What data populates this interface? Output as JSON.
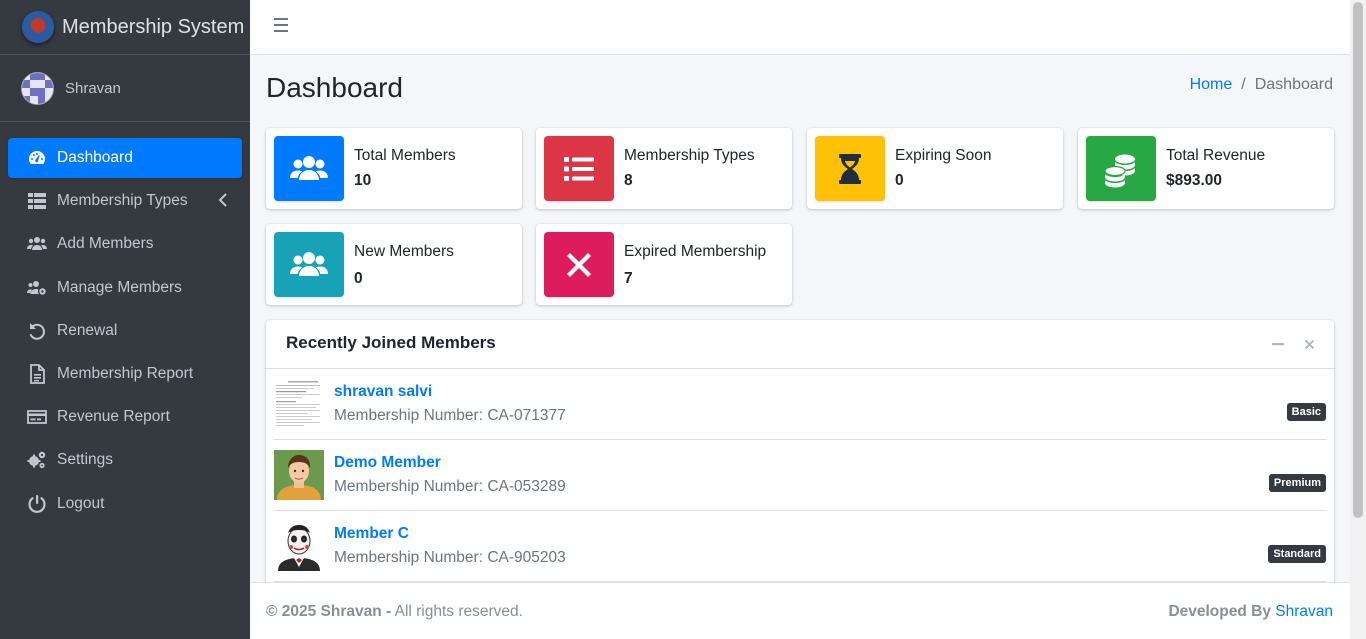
{
  "brand": {
    "title": "Membership System"
  },
  "user": {
    "name": "Shravan"
  },
  "sidebar": {
    "items": [
      {
        "label": "Dashboard",
        "icon": "tachometer-icon",
        "active": true
      },
      {
        "label": "Membership Types",
        "icon": "table-icon",
        "has_submenu": true
      },
      {
        "label": "Add Members",
        "icon": "users-icon"
      },
      {
        "label": "Manage Members",
        "icon": "users-cog-icon"
      },
      {
        "label": "Renewal",
        "icon": "undo-icon"
      },
      {
        "label": "Membership Report",
        "icon": "file-icon"
      },
      {
        "label": "Revenue Report",
        "icon": "credit-card-icon"
      },
      {
        "label": "Settings",
        "icon": "cogs-icon"
      },
      {
        "label": "Logout",
        "icon": "power-off-icon"
      }
    ]
  },
  "header": {
    "title": "Dashboard"
  },
  "breadcrumb": {
    "home": "Home",
    "current": "Dashboard",
    "separator": "/"
  },
  "info_boxes": [
    {
      "label": "Total Members",
      "value": "10",
      "color": "#007bff",
      "icon": "users-icon"
    },
    {
      "label": "Membership Types",
      "value": "8",
      "color": "#dc3545",
      "icon": "list-icon"
    },
    {
      "label": "Expiring Soon",
      "value": "0",
      "color": "#ffc107",
      "icon": "hourglass-icon"
    },
    {
      "label": "Total Revenue",
      "value": "$893.00",
      "color": "#28a745",
      "icon": "coins-icon"
    },
    {
      "label": "New Members",
      "value": "0",
      "color": "#17a2b8",
      "icon": "users-icon"
    },
    {
      "label": "Expired Membership",
      "value": "7",
      "color": "#dc1c5c",
      "icon": "times-icon"
    }
  ],
  "recent": {
    "title": "Recently Joined Members",
    "members": [
      {
        "name": "shravan salvi",
        "number_label": "Membership Number:",
        "number": "CA-071377",
        "type": "Basic"
      },
      {
        "name": "Demo Member",
        "number_label": "Membership Number:",
        "number": "CA-053289",
        "type": "Premium"
      },
      {
        "name": "Member C",
        "number_label": "Membership Number:",
        "number": "CA-905203",
        "type": "Standard"
      }
    ]
  },
  "footer": {
    "copyright": "© 2025 Shravan -",
    "rights": "All rights reserved.",
    "developed_by": "Developed By",
    "developer": "Shravan"
  }
}
